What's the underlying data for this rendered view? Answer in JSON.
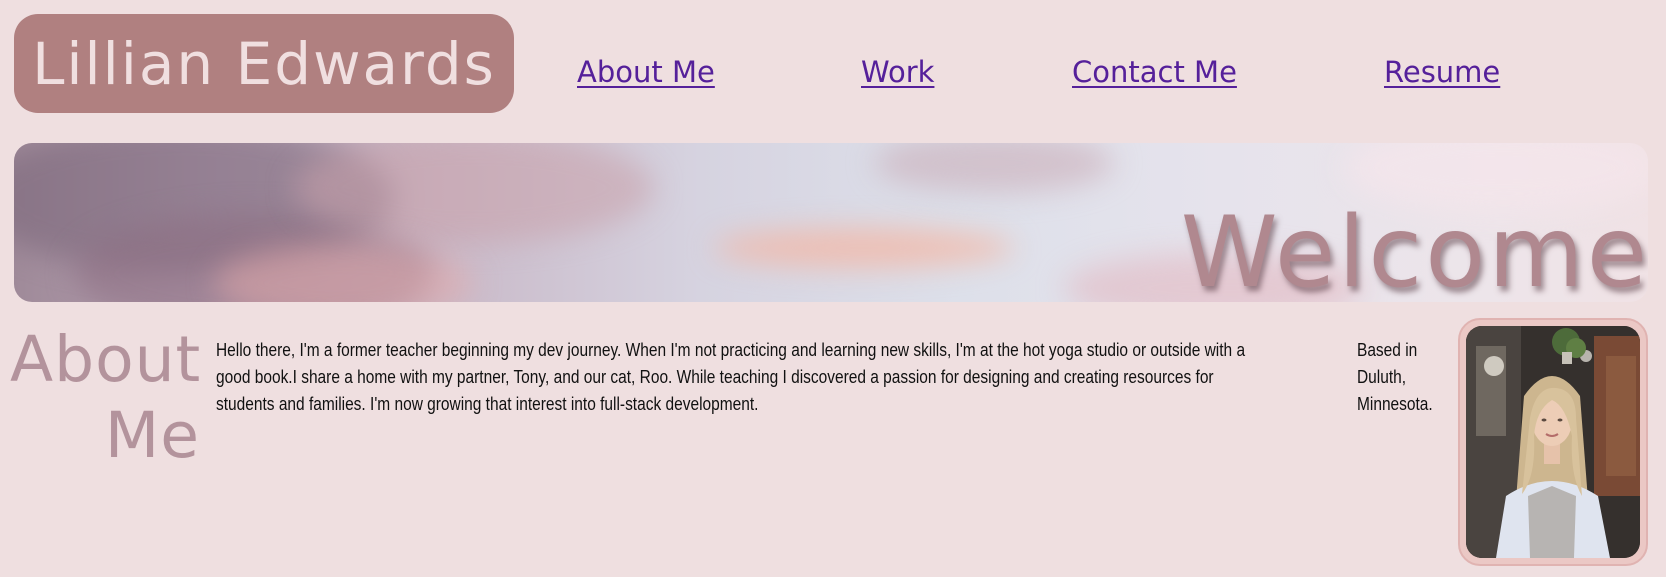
{
  "header": {
    "name": "Lillian Edwards",
    "nav": [
      {
        "label": "About Me"
      },
      {
        "label": "Work"
      },
      {
        "label": "Contact Me"
      },
      {
        "label": "Resume"
      }
    ]
  },
  "hero": {
    "heading": "Welcome"
  },
  "about": {
    "title_line1": "About",
    "title_line2": "Me",
    "bio_lines": [
      "Hello there, I'm a former teacher beginning my dev journey. When I'm not practicing and learning new skills, I'm at the hot yoga studio or outside with a",
      "good book.I share a home with my partner, Tony, and our cat, Roo. While teaching I discovered a passion for designing and creating resources for",
      "students and families. I'm now growing that interest into full-stack development."
    ],
    "location_lines": [
      "Based in",
      "Duluth,",
      "Minnesota."
    ]
  },
  "colors": {
    "background": "#efdfe0",
    "name_badge": "#b08080",
    "name_text": "#f0dfe0",
    "link": "#55209a",
    "heading_muted": "#b3939c",
    "welcome_text": "#b0888f"
  }
}
